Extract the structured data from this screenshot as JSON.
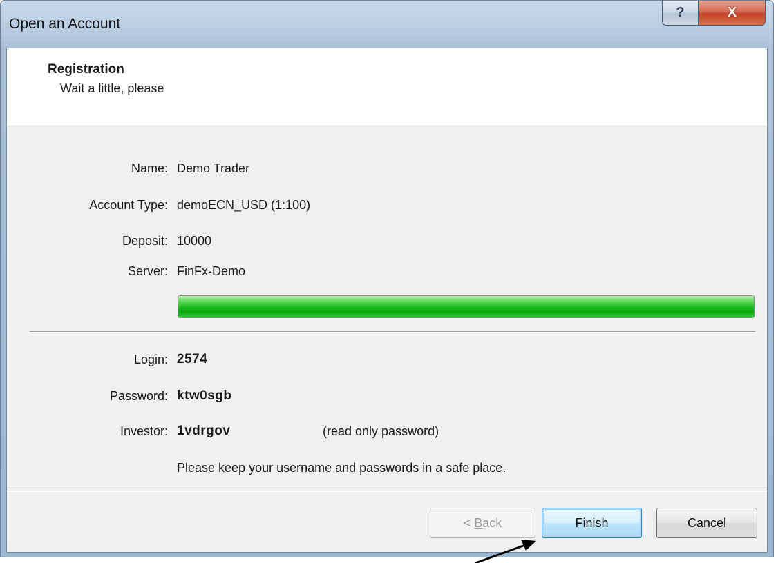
{
  "window": {
    "title": "Open an Account",
    "help_label": "?",
    "close_label": "X"
  },
  "header": {
    "title": "Registration",
    "subtitle": "Wait a little, please"
  },
  "details": [
    {
      "label": "Name:",
      "value": "Demo Trader"
    },
    {
      "label": "Account Type:",
      "value": "demoECN_USD (1:100)"
    },
    {
      "label": "Deposit:",
      "value": "10000"
    },
    {
      "label": "Server:",
      "value": "FinFx-Demo"
    }
  ],
  "progress": {
    "percent": 100,
    "color": "#13b81a"
  },
  "credentials": [
    {
      "label": "Login:",
      "value": "2574"
    },
    {
      "label": "Password:",
      "value": "ktw0sgb"
    },
    {
      "label": "Investor:",
      "value": "1vdrgov",
      "note": "(read only password)"
    }
  ],
  "safety_note": "Please keep your username and passwords in a safe place.",
  "buttons": {
    "back_prefix": "< ",
    "back_underline": "B",
    "back_rest": "ack",
    "finish": "Finish",
    "cancel": "Cancel"
  }
}
